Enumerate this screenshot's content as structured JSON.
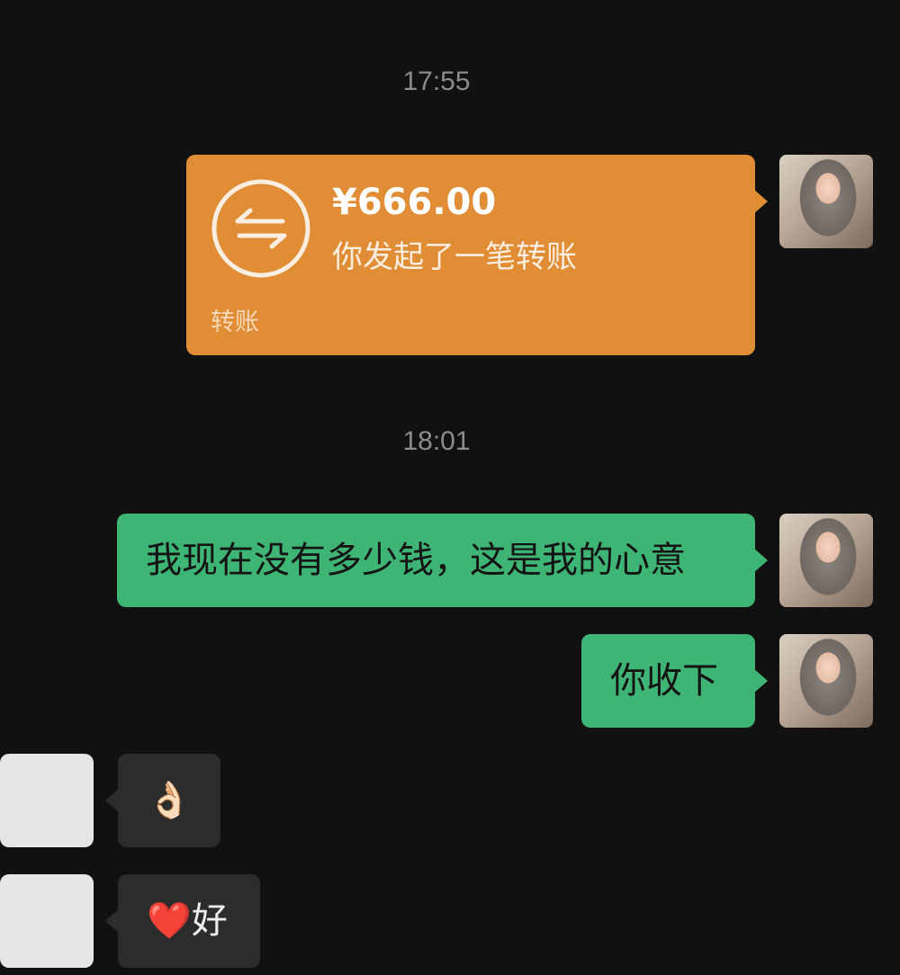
{
  "timestamps": [
    "17:55",
    "18:01"
  ],
  "transfer": {
    "amount": "¥666.00",
    "description": "你发起了一笔转账",
    "label": "转账",
    "icon": "transfer-arrows-icon",
    "color": "#e08d35"
  },
  "messages": {
    "me_1": "我现在没有多少钱，这是我的心意",
    "me_2": "你收下",
    "other_1": "👌🏻",
    "other_2_emoji": "❤️",
    "other_2_text": "好"
  },
  "colors": {
    "background": "#111111",
    "outgoing_bubble": "#3eb575",
    "incoming_bubble": "#2c2c2c",
    "timestamp": "#8c8c8c"
  }
}
